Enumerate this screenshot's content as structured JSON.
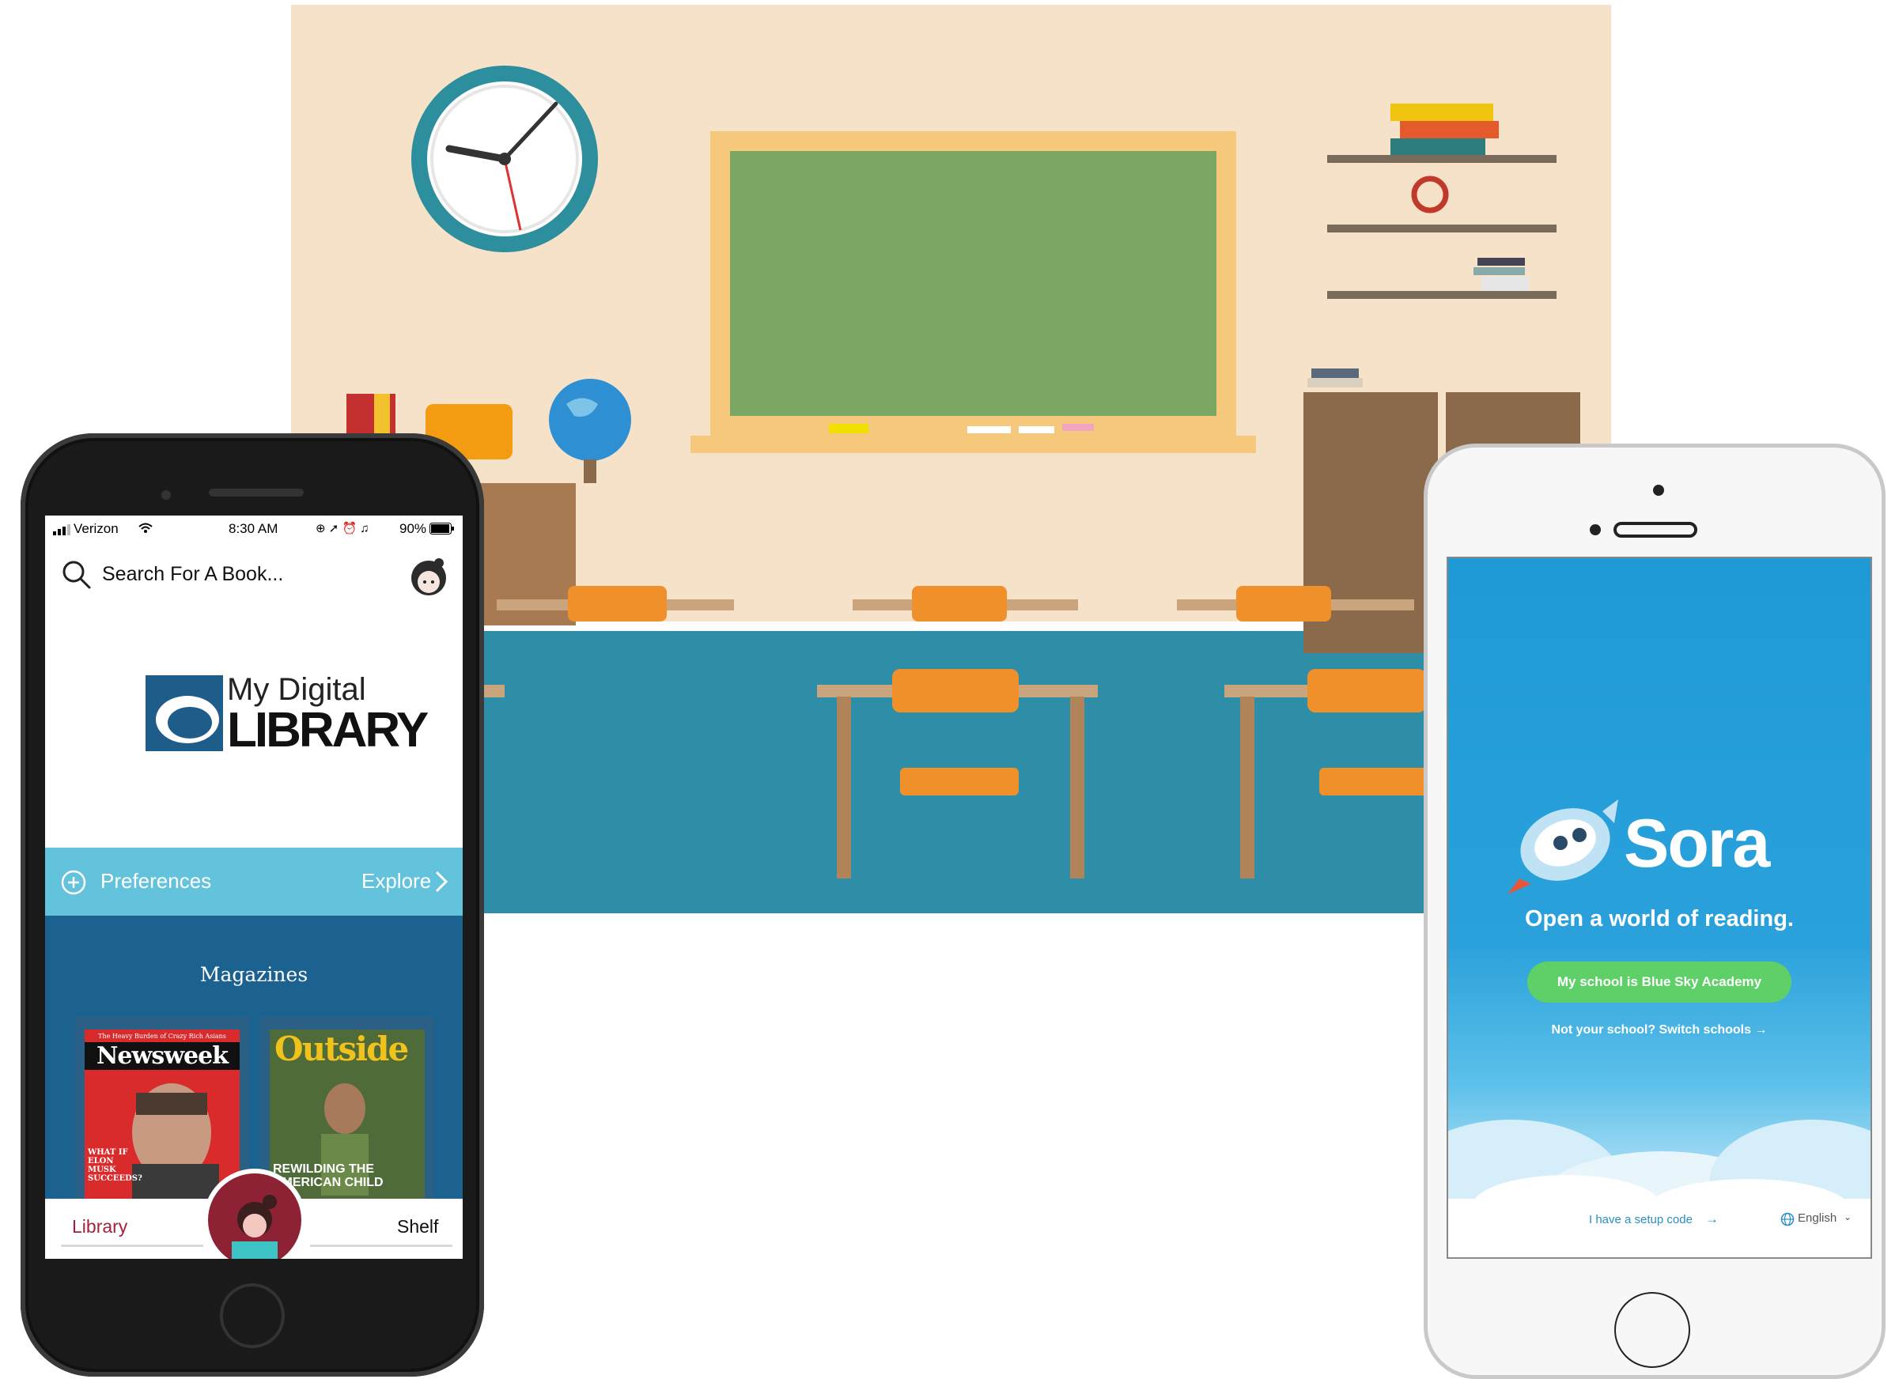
{
  "libby": {
    "status": {
      "carrier": "Verizon",
      "time": "8:30 AM",
      "battery": "90%"
    },
    "search_placeholder": "Search For A Book...",
    "logo": {
      "line1": "My Digital",
      "line2": "LIBRARY"
    },
    "preferences_label": "Preferences",
    "explore_label": "Explore",
    "magazines_title": "Magazines",
    "magazines": [
      {
        "name": "Newsweek",
        "tagline": "The Heavy Burden of Crazy Rich Asians",
        "cover_text": "WHAT IF ELON MUSK SUCCEEDS?"
      },
      {
        "name": "Outside",
        "cover_text": "REWILDING THE AMERICAN CHILD"
      }
    ],
    "tabs": {
      "library": "Library",
      "shelf": "Shelf"
    },
    "colors": {
      "accent": "#a5213f",
      "preferences_bar": "#64c3dc",
      "magazines_bg": "#1c6290"
    }
  },
  "sora": {
    "app_name": "Sora",
    "tagline": "Open a world of reading.",
    "school_button": "My school is Blue Sky Academy",
    "switch_link": "Not your school? Switch schools",
    "setup_link": "I have a setup code",
    "language": "English",
    "colors": {
      "primary": "#1f9ad7",
      "button": "#5fcf68",
      "link": "#2a8fc4"
    }
  }
}
